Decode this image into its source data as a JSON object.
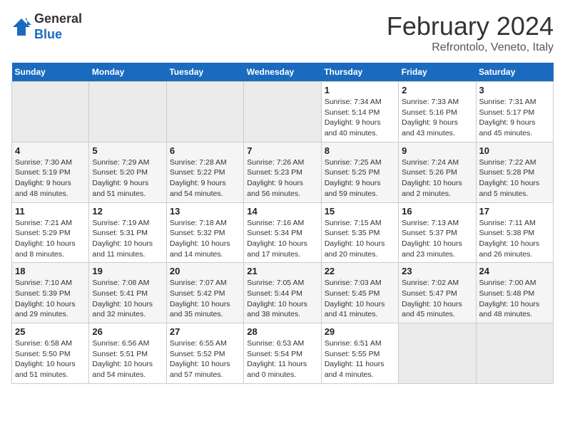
{
  "header": {
    "logo": {
      "general": "General",
      "blue": "Blue"
    },
    "title": "February 2024",
    "subtitle": "Refrontolo, Veneto, Italy"
  },
  "calendar": {
    "days_of_week": [
      "Sunday",
      "Monday",
      "Tuesday",
      "Wednesday",
      "Thursday",
      "Friday",
      "Saturday"
    ],
    "weeks": [
      [
        {
          "day": "",
          "info": ""
        },
        {
          "day": "",
          "info": ""
        },
        {
          "day": "",
          "info": ""
        },
        {
          "day": "",
          "info": ""
        },
        {
          "day": "1",
          "info": "Sunrise: 7:34 AM\nSunset: 5:14 PM\nDaylight: 9 hours\nand 40 minutes."
        },
        {
          "day": "2",
          "info": "Sunrise: 7:33 AM\nSunset: 5:16 PM\nDaylight: 9 hours\nand 43 minutes."
        },
        {
          "day": "3",
          "info": "Sunrise: 7:31 AM\nSunset: 5:17 PM\nDaylight: 9 hours\nand 45 minutes."
        }
      ],
      [
        {
          "day": "4",
          "info": "Sunrise: 7:30 AM\nSunset: 5:19 PM\nDaylight: 9 hours\nand 48 minutes."
        },
        {
          "day": "5",
          "info": "Sunrise: 7:29 AM\nSunset: 5:20 PM\nDaylight: 9 hours\nand 51 minutes."
        },
        {
          "day": "6",
          "info": "Sunrise: 7:28 AM\nSunset: 5:22 PM\nDaylight: 9 hours\nand 54 minutes."
        },
        {
          "day": "7",
          "info": "Sunrise: 7:26 AM\nSunset: 5:23 PM\nDaylight: 9 hours\nand 56 minutes."
        },
        {
          "day": "8",
          "info": "Sunrise: 7:25 AM\nSunset: 5:25 PM\nDaylight: 9 hours\nand 59 minutes."
        },
        {
          "day": "9",
          "info": "Sunrise: 7:24 AM\nSunset: 5:26 PM\nDaylight: 10 hours\nand 2 minutes."
        },
        {
          "day": "10",
          "info": "Sunrise: 7:22 AM\nSunset: 5:28 PM\nDaylight: 10 hours\nand 5 minutes."
        }
      ],
      [
        {
          "day": "11",
          "info": "Sunrise: 7:21 AM\nSunset: 5:29 PM\nDaylight: 10 hours\nand 8 minutes."
        },
        {
          "day": "12",
          "info": "Sunrise: 7:19 AM\nSunset: 5:31 PM\nDaylight: 10 hours\nand 11 minutes."
        },
        {
          "day": "13",
          "info": "Sunrise: 7:18 AM\nSunset: 5:32 PM\nDaylight: 10 hours\nand 14 minutes."
        },
        {
          "day": "14",
          "info": "Sunrise: 7:16 AM\nSunset: 5:34 PM\nDaylight: 10 hours\nand 17 minutes."
        },
        {
          "day": "15",
          "info": "Sunrise: 7:15 AM\nSunset: 5:35 PM\nDaylight: 10 hours\nand 20 minutes."
        },
        {
          "day": "16",
          "info": "Sunrise: 7:13 AM\nSunset: 5:37 PM\nDaylight: 10 hours\nand 23 minutes."
        },
        {
          "day": "17",
          "info": "Sunrise: 7:11 AM\nSunset: 5:38 PM\nDaylight: 10 hours\nand 26 minutes."
        }
      ],
      [
        {
          "day": "18",
          "info": "Sunrise: 7:10 AM\nSunset: 5:39 PM\nDaylight: 10 hours\nand 29 minutes."
        },
        {
          "day": "19",
          "info": "Sunrise: 7:08 AM\nSunset: 5:41 PM\nDaylight: 10 hours\nand 32 minutes."
        },
        {
          "day": "20",
          "info": "Sunrise: 7:07 AM\nSunset: 5:42 PM\nDaylight: 10 hours\nand 35 minutes."
        },
        {
          "day": "21",
          "info": "Sunrise: 7:05 AM\nSunset: 5:44 PM\nDaylight: 10 hours\nand 38 minutes."
        },
        {
          "day": "22",
          "info": "Sunrise: 7:03 AM\nSunset: 5:45 PM\nDaylight: 10 hours\nand 41 minutes."
        },
        {
          "day": "23",
          "info": "Sunrise: 7:02 AM\nSunset: 5:47 PM\nDaylight: 10 hours\nand 45 minutes."
        },
        {
          "day": "24",
          "info": "Sunrise: 7:00 AM\nSunset: 5:48 PM\nDaylight: 10 hours\nand 48 minutes."
        }
      ],
      [
        {
          "day": "25",
          "info": "Sunrise: 6:58 AM\nSunset: 5:50 PM\nDaylight: 10 hours\nand 51 minutes."
        },
        {
          "day": "26",
          "info": "Sunrise: 6:56 AM\nSunset: 5:51 PM\nDaylight: 10 hours\nand 54 minutes."
        },
        {
          "day": "27",
          "info": "Sunrise: 6:55 AM\nSunset: 5:52 PM\nDaylight: 10 hours\nand 57 minutes."
        },
        {
          "day": "28",
          "info": "Sunrise: 6:53 AM\nSunset: 5:54 PM\nDaylight: 11 hours\nand 0 minutes."
        },
        {
          "day": "29",
          "info": "Sunrise: 6:51 AM\nSunset: 5:55 PM\nDaylight: 11 hours\nand 4 minutes."
        },
        {
          "day": "",
          "info": ""
        },
        {
          "day": "",
          "info": ""
        }
      ]
    ]
  }
}
